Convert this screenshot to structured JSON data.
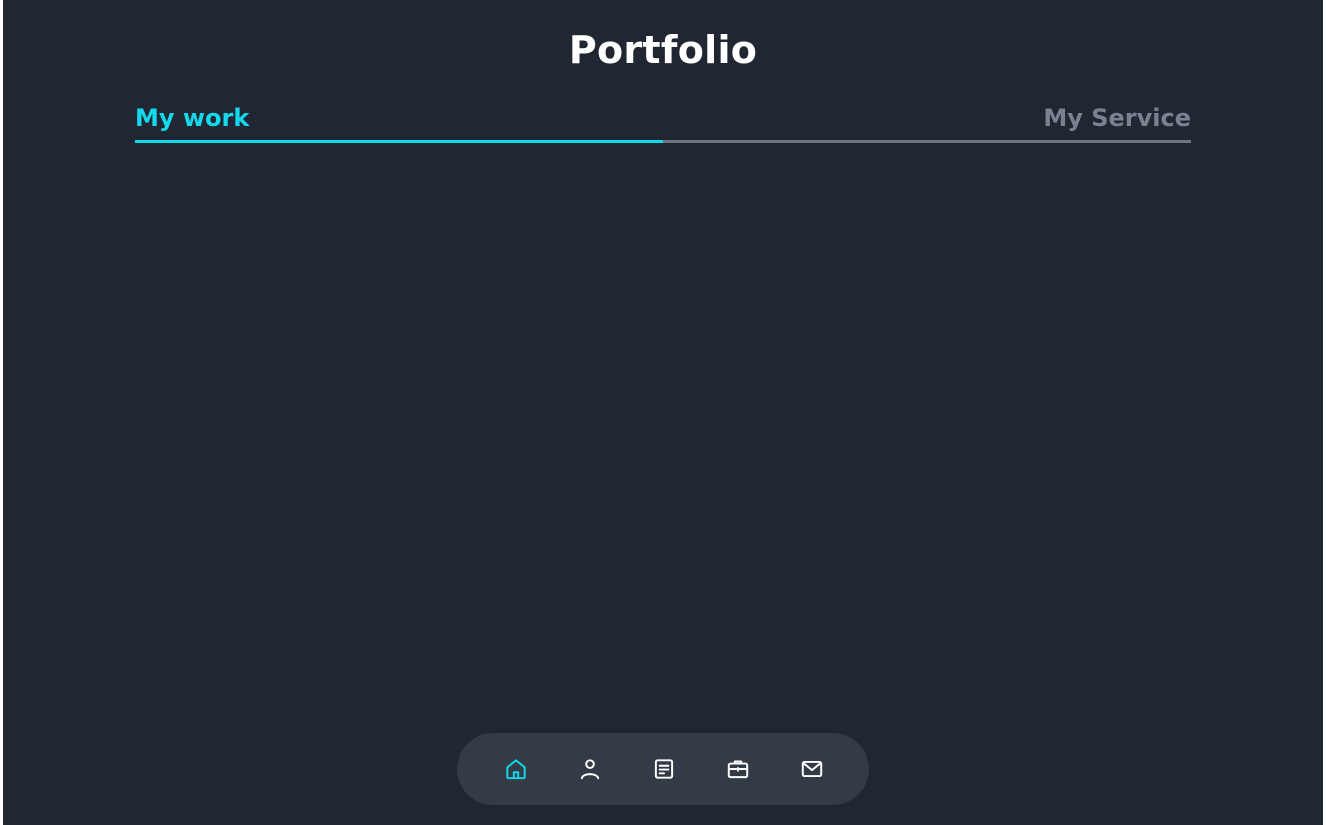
{
  "page": {
    "title": "Portfolio"
  },
  "tabs": [
    {
      "label": "My work",
      "active": true
    },
    {
      "label": "My Service",
      "active": false
    }
  ],
  "tab_progress": 0.5,
  "nav": {
    "items": [
      {
        "icon": "home-icon",
        "active": true
      },
      {
        "icon": "user-icon",
        "active": false
      },
      {
        "icon": "document-icon",
        "active": false
      },
      {
        "icon": "briefcase-icon",
        "active": false
      },
      {
        "icon": "mail-icon",
        "active": false
      }
    ]
  },
  "colors": {
    "background": "#212732",
    "accent": "#14d8ec",
    "inactive_text": "#7b8190",
    "navbar": "#333b46",
    "icon": "#ffffff"
  }
}
